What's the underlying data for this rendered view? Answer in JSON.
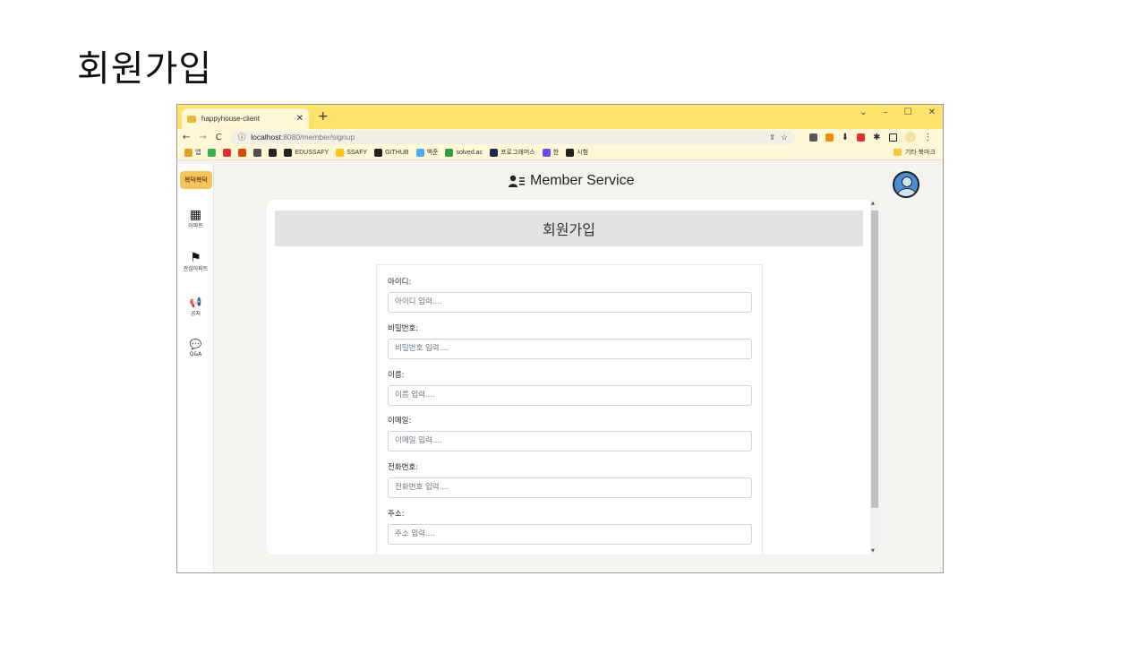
{
  "slide": {
    "title": "회원가입"
  },
  "browser": {
    "tab_title": "happyhouse-client",
    "new_tab": "+",
    "window_controls": [
      "⌄",
      "–",
      "☐",
      "✕"
    ],
    "url_host": "localhost",
    "url_path": ":8080/member/signup",
    "bookmarks": [
      {
        "label": "앱",
        "color": "#e0a020"
      },
      {
        "label": "",
        "color": "#37b24d"
      },
      {
        "label": "",
        "color": "#e03131"
      },
      {
        "label": "",
        "color": "#d9480f"
      },
      {
        "label": "",
        "color": "#495057"
      },
      {
        "label": "",
        "color": "#222"
      },
      {
        "label": "EDUSSAFY",
        "color": "#222"
      },
      {
        "label": "SSAFY",
        "color": "#fcc419"
      },
      {
        "label": "GITHUB",
        "color": "#222"
      },
      {
        "label": "백준",
        "color": "#4dabf7"
      },
      {
        "label": "solved.ac",
        "color": "#2f9e44"
      },
      {
        "label": "프로그래머스",
        "color": "#1c2b4a"
      },
      {
        "label": "한",
        "color": "#7048e8"
      },
      {
        "label": "시험",
        "color": "#222"
      }
    ],
    "other_bookmarks": "기타 북마크"
  },
  "app": {
    "logo": "복덕복덕",
    "nav": [
      {
        "label": "아파트",
        "icon": "building-icon",
        "glyph": "▦"
      },
      {
        "label": "관심아파트",
        "icon": "flag-icon",
        "glyph": "⚑"
      },
      {
        "label": "공지",
        "icon": "megaphone-icon",
        "glyph": "📢"
      },
      {
        "label": "Q&A",
        "icon": "comments-icon",
        "glyph": "💬"
      }
    ],
    "header": "Member Service",
    "card_title": "회원가입"
  },
  "form": {
    "fields": [
      {
        "label": "아이디:",
        "placeholder": "아이디 입력...."
      },
      {
        "label": "비밀번호:",
        "placeholder": "비밀번호 입력...."
      },
      {
        "label": "이름:",
        "placeholder": "이름 입력...."
      },
      {
        "label": "이메일:",
        "placeholder": "이메일 입력...."
      },
      {
        "label": "전화번호:",
        "placeholder": "전화번호 입력...."
      },
      {
        "label": "주소:",
        "placeholder": "주소 입력...."
      }
    ]
  }
}
